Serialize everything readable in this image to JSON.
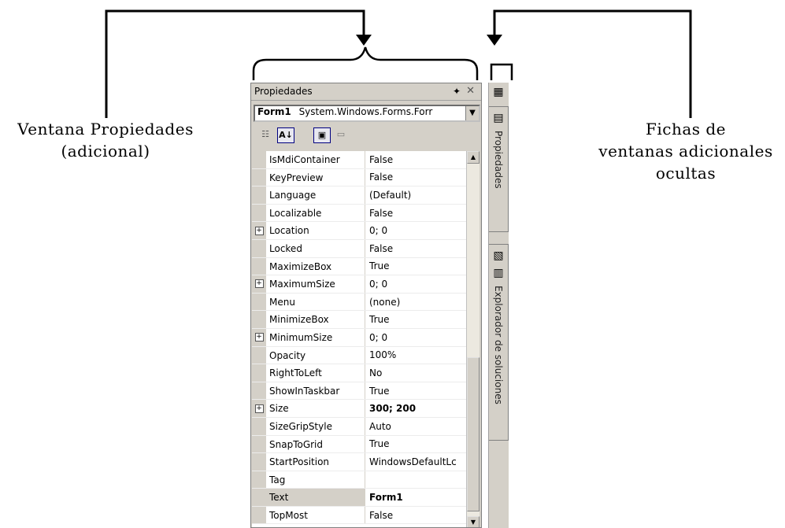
{
  "annotations": {
    "left": [
      "Ventana Propiedades",
      "(adicional)"
    ],
    "right": [
      "Fichas de",
      "ventanas adicionales",
      "ocultas"
    ]
  },
  "panel": {
    "title": "Propiedades",
    "pin_icon": "pin-icon",
    "close_icon": "close-icon",
    "object_name": "Form1",
    "object_type": "System.Windows.Forms.Forr",
    "toolbar_icons": [
      "categorized-icon",
      "alphabetical-icon",
      "properties-icon",
      "events-icon"
    ]
  },
  "properties": [
    {
      "name": "IsMdiContainer",
      "value": "False",
      "expandable": false,
      "bold": false
    },
    {
      "name": "KeyPreview",
      "value": "False",
      "expandable": false,
      "bold": false
    },
    {
      "name": "Language",
      "value": "(Default)",
      "expandable": false,
      "bold": false
    },
    {
      "name": "Localizable",
      "value": "False",
      "expandable": false,
      "bold": false
    },
    {
      "name": "Location",
      "value": "0; 0",
      "expandable": true,
      "bold": false
    },
    {
      "name": "Locked",
      "value": "False",
      "expandable": false,
      "bold": false
    },
    {
      "name": "MaximizeBox",
      "value": "True",
      "expandable": false,
      "bold": false
    },
    {
      "name": "MaximumSize",
      "value": "0; 0",
      "expandable": true,
      "bold": false
    },
    {
      "name": "Menu",
      "value": "(none)",
      "expandable": false,
      "bold": false
    },
    {
      "name": "MinimizeBox",
      "value": "True",
      "expandable": false,
      "bold": false
    },
    {
      "name": "MinimumSize",
      "value": "0; 0",
      "expandable": true,
      "bold": false
    },
    {
      "name": "Opacity",
      "value": "100%",
      "expandable": false,
      "bold": false
    },
    {
      "name": "RightToLeft",
      "value": "No",
      "expandable": false,
      "bold": false
    },
    {
      "name": "ShowInTaskbar",
      "value": "True",
      "expandable": false,
      "bold": false
    },
    {
      "name": "Size",
      "value": "300; 200",
      "expandable": true,
      "bold": true
    },
    {
      "name": "SizeGripStyle",
      "value": "Auto",
      "expandable": false,
      "bold": false
    },
    {
      "name": "SnapToGrid",
      "value": "True",
      "expandable": false,
      "bold": false
    },
    {
      "name": "StartPosition",
      "value": "WindowsDefaultLc",
      "expandable": false,
      "bold": false
    },
    {
      "name": "Tag",
      "value": "",
      "expandable": false,
      "bold": false
    },
    {
      "name": "Text",
      "value": "Form1",
      "expandable": false,
      "bold": true,
      "selected": true
    },
    {
      "name": "TopMost",
      "value": "False",
      "expandable": false,
      "bold": false
    }
  ],
  "side_tabs": [
    {
      "label": "Propiedades",
      "icon": "properties-window-icon"
    },
    {
      "label": "Explorador de soluciones",
      "icon": "solution-explorer-icon"
    }
  ]
}
